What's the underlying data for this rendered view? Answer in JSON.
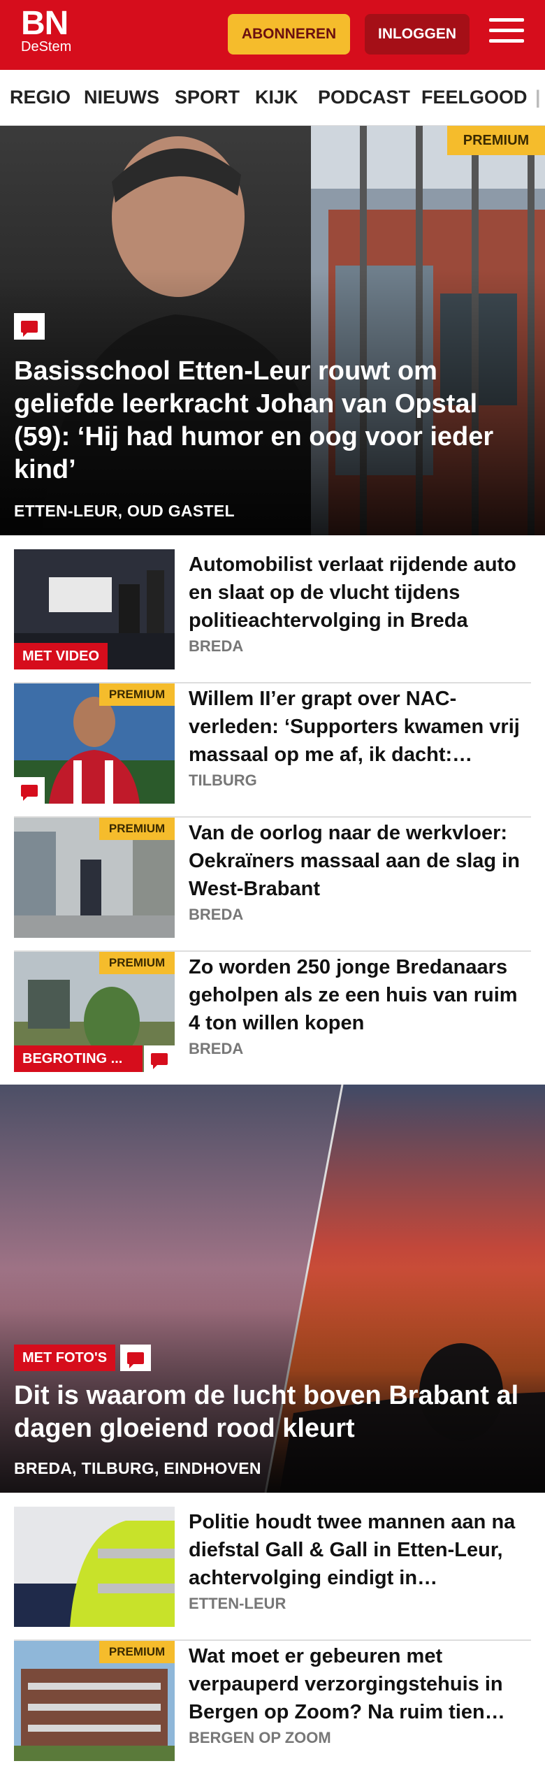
{
  "header": {
    "logo_main": "BN",
    "logo_sub": "DeStem",
    "subscribe_label": "ABONNEREN",
    "login_label": "INLOGGEN",
    "brand_color": "#d60d1c"
  },
  "nav": {
    "items": [
      "REGIO",
      "NIEUWS",
      "SPORT",
      "KIJK",
      "PODCAST",
      "FEELGOOD"
    ]
  },
  "hero1": {
    "premium": "PREMIUM",
    "title": "Basisschool Etten-Leur rouwt om geliefde leerkracht Johan van Opstal (59): ‘Hij had humor en oog voor ieder kind’",
    "locations": "ETTEN-LEUR, OUD GASTEL"
  },
  "articles": [
    {
      "title": "Automobilist verlaat rijdende auto en slaat op de vlucht tijdens politieachtervolging in Breda",
      "location": "BREDA",
      "tag": "MET VIDEO"
    },
    {
      "title": "Willem II’er grapt over NAC-verleden: ‘Supporters kwamen vrij massaal op me af, ik dacht:…",
      "location": "TILBURG",
      "premium": "PREMIUM"
    },
    {
      "title": "Van de oorlog naar de werkvloer: Oekraïners massaal aan de slag in West-Brabant",
      "location": "BREDA",
      "premium": "PREMIUM"
    },
    {
      "title": "Zo worden 250 jonge Bredanaars geholpen als ze een huis van ruim 4 ton willen kopen",
      "location": "BREDA",
      "premium": "PREMIUM",
      "tag": "BEGROTING ..."
    }
  ],
  "hero2": {
    "tag": "MET FOTO'S",
    "title": "Dit is waarom de lucht boven Brabant al dagen gloeiend rood kleurt",
    "locations": "BREDA, TILBURG, EINDHOVEN"
  },
  "articles2": [
    {
      "title": "Politie houdt twee mannen aan na diefstal Gall & Gall in Etten-Leur, achtervolging eindigt in…",
      "location": "ETTEN-LEUR"
    },
    {
      "title": "Wat moet er gebeuren met verpauperd verzorgingstehuis in Bergen op Zoom? Na ruim tien…",
      "location": "BERGEN OP ZOOM",
      "premium": "PREMIUM"
    }
  ]
}
